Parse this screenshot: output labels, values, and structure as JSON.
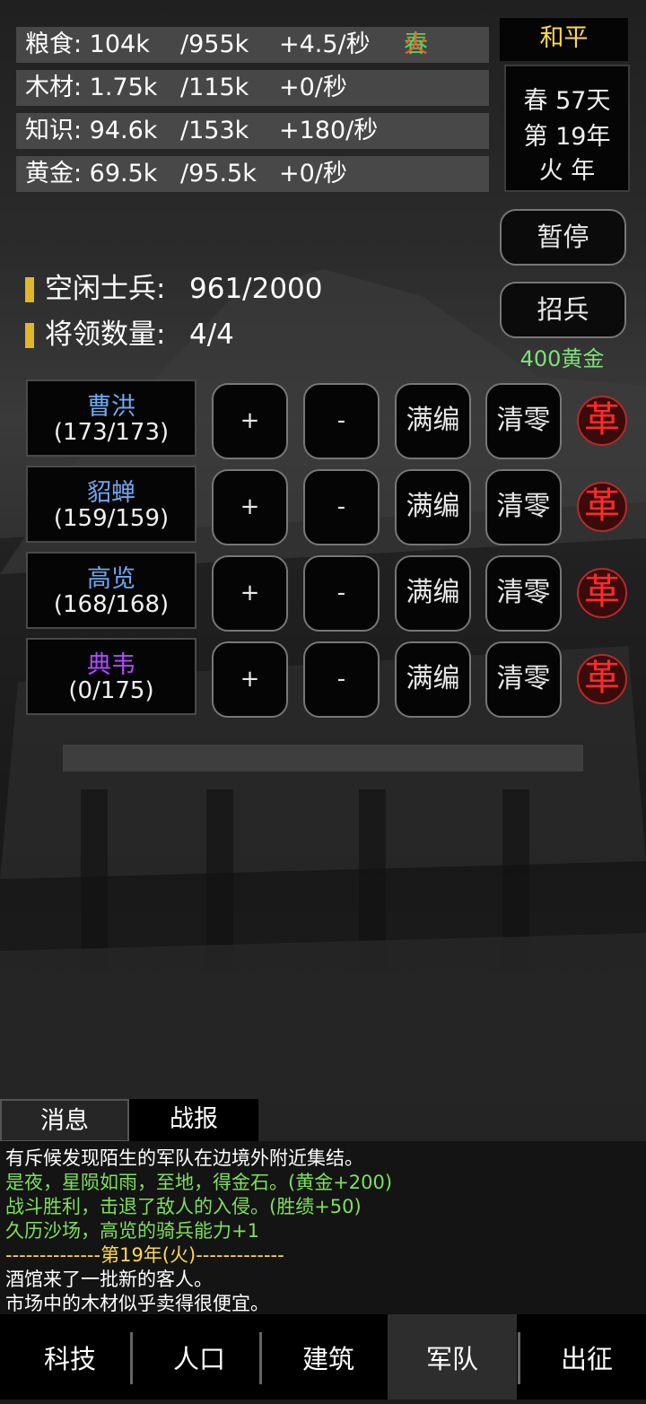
{
  "resources": [
    {
      "name": "粮食: 104k",
      "max": "/955k",
      "rate": "+4.5/秒"
    },
    {
      "name": "木材: 1.75k",
      "max": "/115k",
      "rate": "+0/秒"
    },
    {
      "name": "知识: 94.6k",
      "max": "/153k",
      "rate": "+180/秒"
    },
    {
      "name": "黄金: 69.5k",
      "max": "/95.5k",
      "rate": "+0/秒"
    }
  ],
  "season": {
    "spring": "春",
    "fire": "火",
    "spring_color": "#58d25c",
    "fire_color": "#ff5a32"
  },
  "status": {
    "peace": "和平"
  },
  "date": {
    "line1": "春 57天",
    "line2": "第 19年",
    "line3": "火 年"
  },
  "buttons": {
    "pause": "暂停",
    "recruit": "招兵",
    "recruit_cost": "400黄金"
  },
  "stats": {
    "idle_soldiers_label": "空闲士兵:",
    "idle_soldiers_value": "961/2000",
    "generals_label": "将领数量:",
    "generals_value": "4/4"
  },
  "generals": [
    {
      "name": "曹洪",
      "count": "(173/173)",
      "color": "#6fa8f0"
    },
    {
      "name": "貂蝉",
      "count": "(159/159)",
      "color": "#6fa8f0"
    },
    {
      "name": "高览",
      "count": "(168/168)",
      "color": "#6fa8f0"
    },
    {
      "name": "典韦",
      "count": "(0/175)",
      "color": "#b04bff"
    }
  ],
  "general_actions": {
    "plus": "+",
    "minus": "-",
    "fill": "满编",
    "clear": "清零",
    "dismiss": "革"
  },
  "tabs": {
    "messages": "消息",
    "battle_report": "战报"
  },
  "log": [
    {
      "text": "有斥候发现陌生的军队在边境外附近集结。",
      "color": "#ffffff"
    },
    {
      "text": "是夜，星陨如雨，至地，得金石。(黄金+200)",
      "color": "#7ee05a"
    },
    {
      "text": "战斗胜利，击退了敌人的入侵。(胜绩+50)",
      "color": "#7ee05a"
    },
    {
      "text": "久历沙场，高览的骑兵能力+1",
      "color": "#7ee05a"
    },
    {
      "text": "--------------第19年(火)-------------",
      "color": "#ffd94a"
    },
    {
      "text": "酒馆来了一批新的客人。",
      "color": "#ffffff"
    },
    {
      "text": "市场中的木材似乎卖得很便宜。",
      "color": "#ffffff"
    }
  ],
  "nav": [
    "科技",
    "人口",
    "建筑",
    "军队",
    "出征"
  ],
  "nav_active": 3
}
